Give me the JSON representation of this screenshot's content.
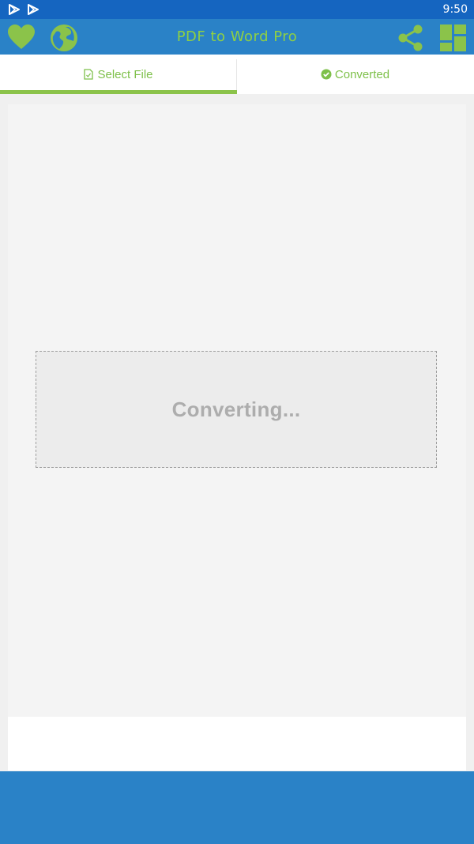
{
  "status_bar": {
    "time": "9:50",
    "icons": [
      "play-store-icon",
      "play-store-icon"
    ]
  },
  "app_bar": {
    "title": "PDF to Word Pro",
    "left_icons": [
      "heart-icon",
      "globe-icon"
    ],
    "right_icons": [
      "share-icon",
      "grid-icon"
    ]
  },
  "tabs": [
    {
      "label": "Select File",
      "icon": "file-icon",
      "selected": true
    },
    {
      "label": "Converted",
      "icon": "check-circle-icon",
      "selected": false
    }
  ],
  "dropzone": {
    "label": "Converting..."
  },
  "colors": {
    "status_bar": "#1565c0",
    "app_bar": "#2a82c7",
    "accent_green": "#8bc34a",
    "title_green": "#8fd043"
  }
}
